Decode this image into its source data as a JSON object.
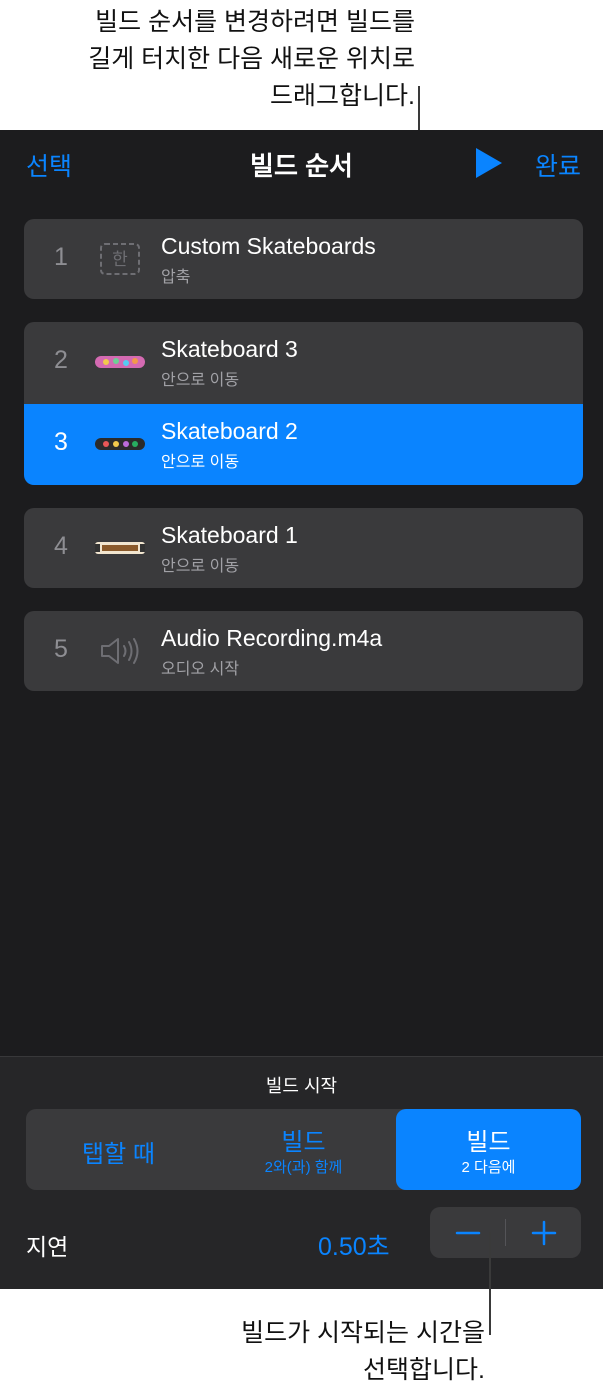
{
  "callouts": {
    "top": "빌드 순서를 변경하려면 빌드를\n길게 터치한 다음 새로운 위치로\n드래그합니다.",
    "bottom": "빌드가 시작되는 시간을\n선택합니다."
  },
  "header": {
    "left_label": "선택",
    "title": "빌드 순서",
    "right_label": "완료",
    "play_icon": "play-icon"
  },
  "builds": [
    {
      "number": "1",
      "name": "Custom Skateboards",
      "effect": "압축",
      "thumbnail": "text-box-icon",
      "thumb_glyph": "한",
      "selected": false
    },
    {
      "number": "2",
      "name": "Skateboard 3",
      "effect": "안으로 이동",
      "thumbnail": "skateboard-thumbnail",
      "selected": false
    },
    {
      "number": "3",
      "name": "Skateboard 2",
      "effect": "안으로 이동",
      "thumbnail": "skateboard-thumbnail",
      "selected": true
    },
    {
      "number": "4",
      "name": "Skateboard 1",
      "effect": "안으로 이동",
      "thumbnail": "skateboard-thumbnail",
      "selected": false
    },
    {
      "number": "5",
      "name": "Audio Recording.m4a",
      "effect": "오디오 시작",
      "thumbnail": "speaker-icon",
      "selected": false
    }
  ],
  "build_start": {
    "label": "빌드 시작",
    "options": [
      {
        "label": "탭할 때",
        "sub": "",
        "active": false
      },
      {
        "label": "빌드",
        "sub": "2와(과) 함께",
        "active": false
      },
      {
        "label": "빌드",
        "sub": "2 다음에",
        "active": true
      }
    ]
  },
  "delay": {
    "label": "지연",
    "value": "0.50초",
    "minus_icon": "minus-icon",
    "plus_icon": "plus-icon"
  },
  "colors": {
    "accent": "#0a84ff",
    "panel": "#1c1c1e",
    "row": "#3a3a3c"
  }
}
